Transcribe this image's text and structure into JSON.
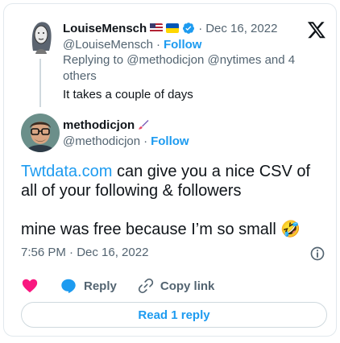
{
  "parent_tweet": {
    "name": "LouiseMensch",
    "handle": "@LouiseMensch",
    "dot": "·",
    "follow_label": "Follow",
    "date": "Dec 16, 2022",
    "reply_prefix": "Replying to",
    "reply_targets": "@methodicjon @nytimes and 4 others",
    "text": "It takes a couple of days"
  },
  "tweet": {
    "name": "methodicjon",
    "handle": "@methodicjon",
    "dot": "·",
    "follow_label": "Follow",
    "link_text": "Twtdata.com",
    "text_rest": " can give you a nice CSV of all of your following & followers",
    "text2": "mine was free because I’m so small 🤣",
    "timestamp": "7:56 PM · Dec 16, 2022"
  },
  "actions": {
    "reply_label": "Reply",
    "copy_link_label": "Copy link",
    "read_replies_label": "Read 1 reply"
  },
  "colors": {
    "accent": "#1d9bf0",
    "like": "#f91880"
  }
}
